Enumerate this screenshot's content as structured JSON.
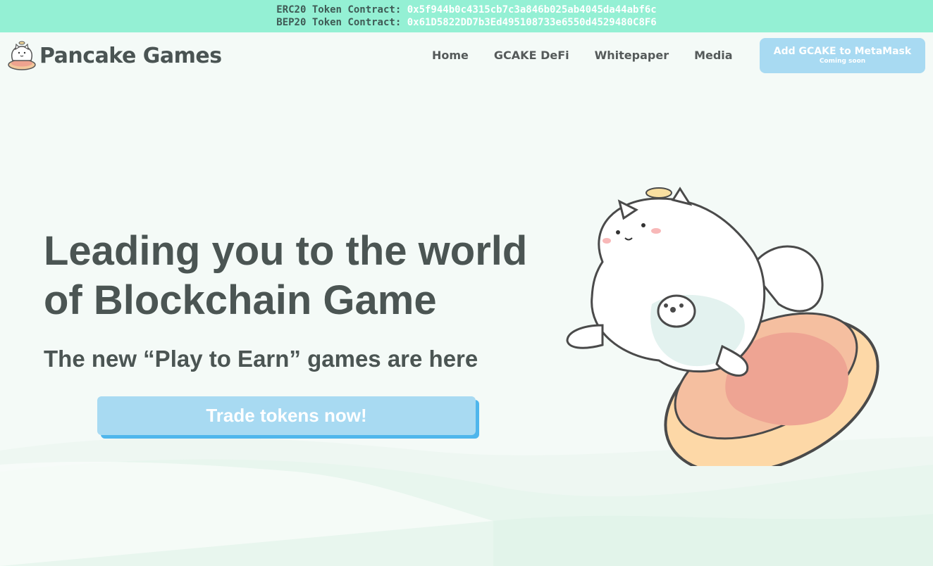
{
  "contracts": {
    "erc20": {
      "label": "ERC20 Token Contract:",
      "address": "0x5f944b0c4315cb7c3a846b025ab4045da44abf6c"
    },
    "bep20": {
      "label": "BEP20 Token Contract:",
      "address": "0x61D5822DD7b3Ed495108733e6550d4529480C8F6"
    }
  },
  "brand": {
    "name": "Pancake Games",
    "icon": "pancake-dog-logo-icon"
  },
  "nav": {
    "items": [
      "Home",
      "GCAKE DeFi",
      "Whitepaper",
      "Media"
    ]
  },
  "metamask": {
    "label": "Add GCAKE to MetaMask",
    "sublabel": "Coming soon"
  },
  "hero": {
    "headline_line1": "Leading you to the world",
    "headline_line2": "of Blockchain Game",
    "subheadline": "The new “Play to Earn” games are here",
    "cta_label": "Trade tokens now!",
    "illustration": "dog-on-pancake-illustration"
  },
  "colors": {
    "contract_bar": "#94f0d4",
    "text_dark": "#4b5553",
    "button_blue": "#a8daf2",
    "button_shadow": "#4fb6ec",
    "background": "#f4faf7"
  }
}
